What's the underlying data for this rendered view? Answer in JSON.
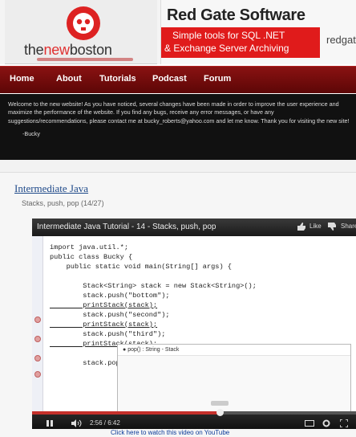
{
  "brand": {
    "prefix": "the",
    "middle": "new",
    "suffix": "boston"
  },
  "ad": {
    "title": "Red Gate Software",
    "line1": "Simple tools for SQL .NET",
    "line2": "& Exchange Server Archiving",
    "domain": "redgate"
  },
  "nav": {
    "items": [
      "Home",
      "About",
      "Tutorials",
      "Podcast",
      "Forum"
    ]
  },
  "notice": {
    "text": "Welcome to the new website! As you have noticed, several changes have been made in order to improve the user experience and maximize the performance of the website. If you find any bugs, receive any error messages, or have any suggestions/recommendations, please contact me at bucky_roberts@yahoo.com and let me know. Thank you for visiting the new site!",
    "signature": "-Bucky"
  },
  "post": {
    "title": "Intermediate Java",
    "subtitle": "Stacks, push, pop (14/27)"
  },
  "video": {
    "title": "Intermediate Java Tutorial - 14 - Stacks, push, pop",
    "like_label": "Like",
    "share_label": "Share",
    "time": "2:56 / 6:42",
    "progress_fraction": 0.58,
    "code_lines": [
      "import java.util.*;",
      "public class Bucky {",
      "    public static void main(String[] args) {",
      "",
      "        Stack<String> stack = new Stack<String>();",
      "        stack.push(\"bottom\");",
      "        printStack(stack);",
      "        stack.push(\"second\");",
      "        printStack(stack);",
      "        stack.push(\"third\");",
      "        printStack(stack);",
      "",
      "        stack.pop()"
    ],
    "autocomplete": "pop() : String - Stack"
  },
  "youtube_link": "Click here to watch this video on YouTube",
  "colors": {
    "nav_red": "#8a1212",
    "ad_red": "#e01b1b",
    "link_blue": "#1f4a8a"
  }
}
